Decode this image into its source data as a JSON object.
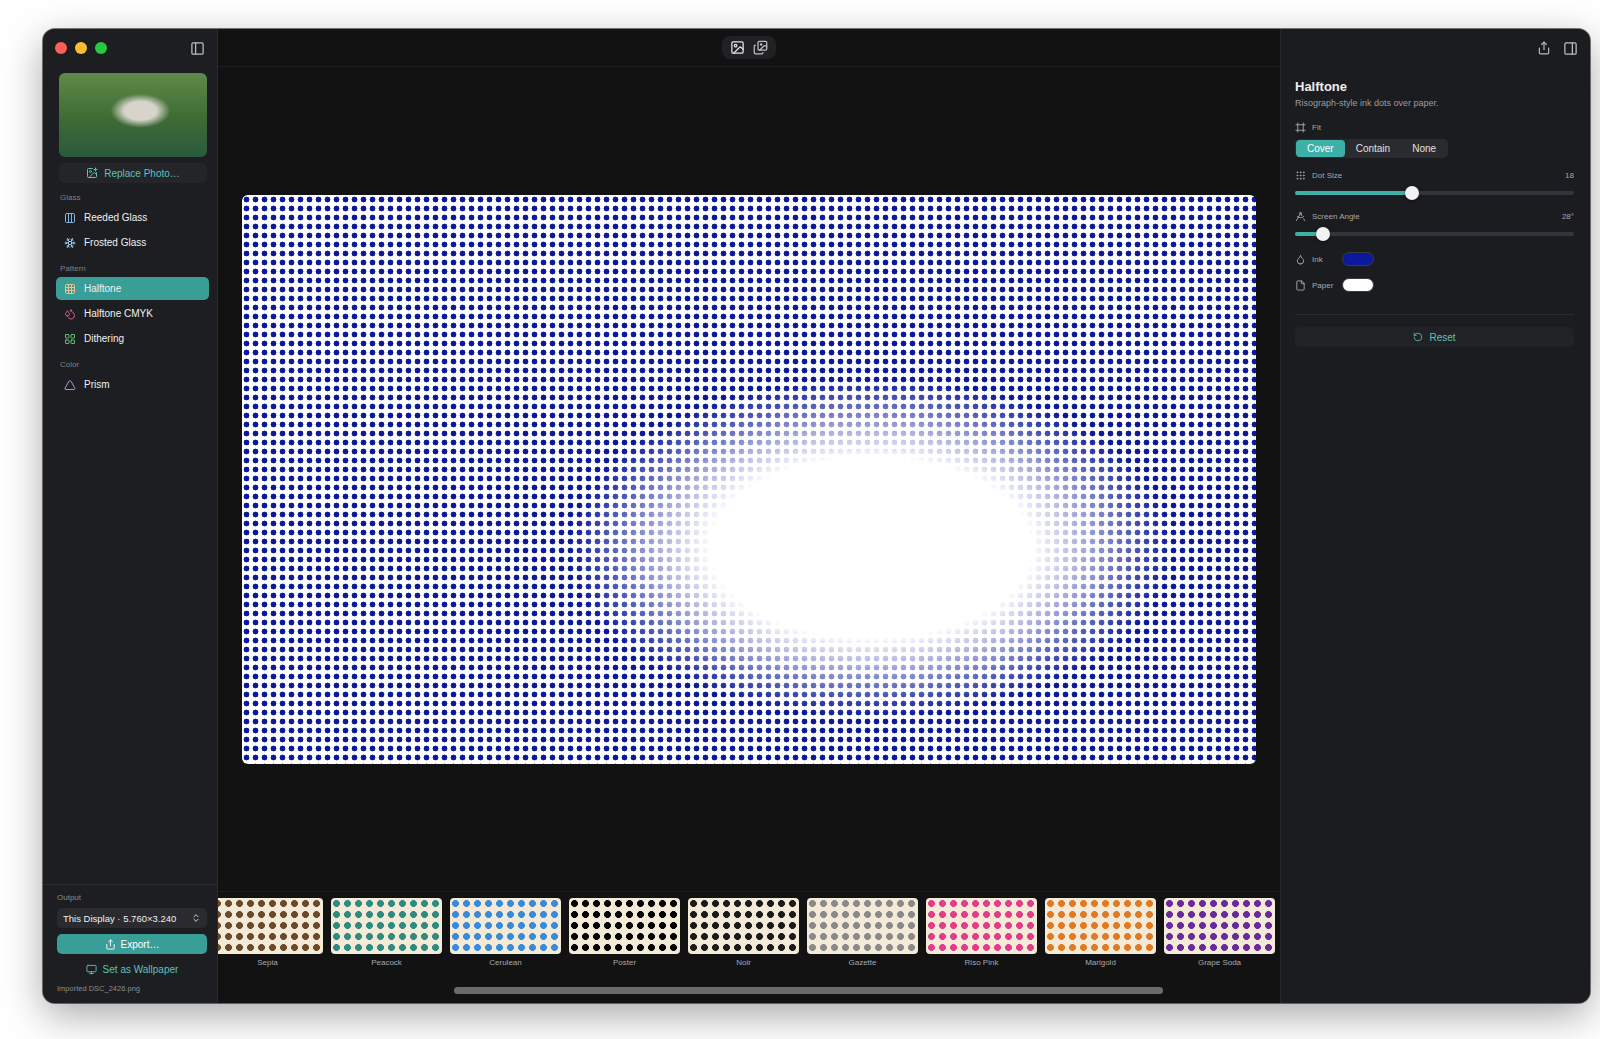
{
  "sidebar": {
    "replace": "Replace Photo…",
    "sections": [
      {
        "title": "Glass",
        "items": [
          {
            "label": "Reeded Glass",
            "selected": false
          },
          {
            "label": "Frosted Glass",
            "selected": false
          }
        ]
      },
      {
        "title": "Pattern",
        "items": [
          {
            "label": "Halftone",
            "selected": true
          },
          {
            "label": "Halftone CMYK",
            "selected": false
          },
          {
            "label": "Dithering",
            "selected": false
          }
        ]
      },
      {
        "title": "Color",
        "items": [
          {
            "label": "Prism",
            "selected": false
          }
        ]
      }
    ],
    "output": {
      "title": "Output",
      "display": "This Display · 5.760×3.240",
      "export": "Export…",
      "wallpaper": "Set as Wallpaper",
      "status": "Imported DSC_2426.png"
    }
  },
  "inspector": {
    "title": "Halftone",
    "subtitle": "Risograph-style ink dots over paper.",
    "controls": [
      {
        "kind": "segmented",
        "label": "Fit",
        "options": [
          {
            "label": "Cover",
            "selected": true
          },
          {
            "label": "Contain",
            "selected": false
          },
          {
            "label": "None",
            "selected": false
          }
        ]
      },
      {
        "kind": "slider",
        "label": "Dot Size",
        "value": "18",
        "level": 0.42
      },
      {
        "kind": "slider",
        "label": "Screen Angle",
        "value": "28°",
        "level": 0.1
      },
      {
        "kind": "color",
        "label": "Ink",
        "color": "#0b1a9c"
      },
      {
        "kind": "color",
        "label": "Paper",
        "color": "#ffffff"
      }
    ],
    "reset": "Reset"
  },
  "presets": [
    {
      "label": "Sepia",
      "color": "#6b4a2a"
    },
    {
      "label": "Peacock",
      "color": "#2f8a80"
    },
    {
      "label": "Cerulean",
      "color": "#3b8ad8"
    },
    {
      "label": "Poster",
      "color": "#000000"
    },
    {
      "label": "Noir",
      "color": "#1a1a1a"
    },
    {
      "label": "Gazette",
      "color": "#8a8a8a"
    },
    {
      "label": "Riso Pink",
      "color": "#e23d8a"
    },
    {
      "label": "Marigold",
      "color": "#e07a24"
    },
    {
      "label": "Grape Soda",
      "color": "#6a2a9a"
    }
  ]
}
